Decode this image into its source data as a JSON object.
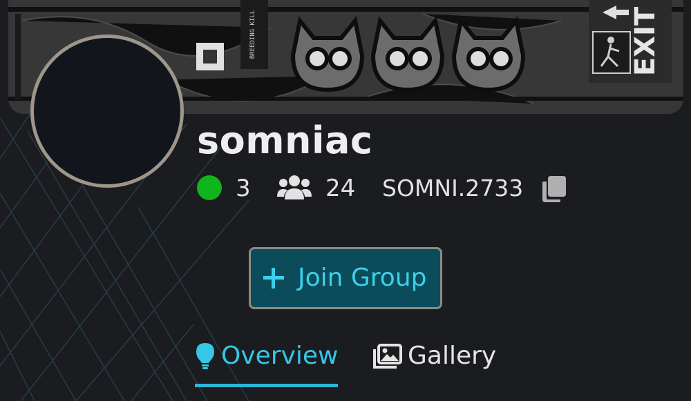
{
  "group": {
    "name": "somniac",
    "online_count": "3",
    "member_count": "24",
    "tag": "SOMNI.2733"
  },
  "actions": {
    "join_label": "Join Group"
  },
  "tabs": [
    {
      "label": "Overview",
      "active": true,
      "icon": "lightbulb-icon"
    },
    {
      "label": "Gallery",
      "active": false,
      "icon": "gallery-icon"
    }
  ],
  "banner": {
    "sign_text": "EXIT",
    "sticker_text": "BREEDING KILL"
  },
  "colors": {
    "background": "#1a1c1f",
    "accent": "#36c6e6",
    "online": "#10b519",
    "button_bg": "#0c4c5a",
    "avatar_border": "#9e968a"
  }
}
